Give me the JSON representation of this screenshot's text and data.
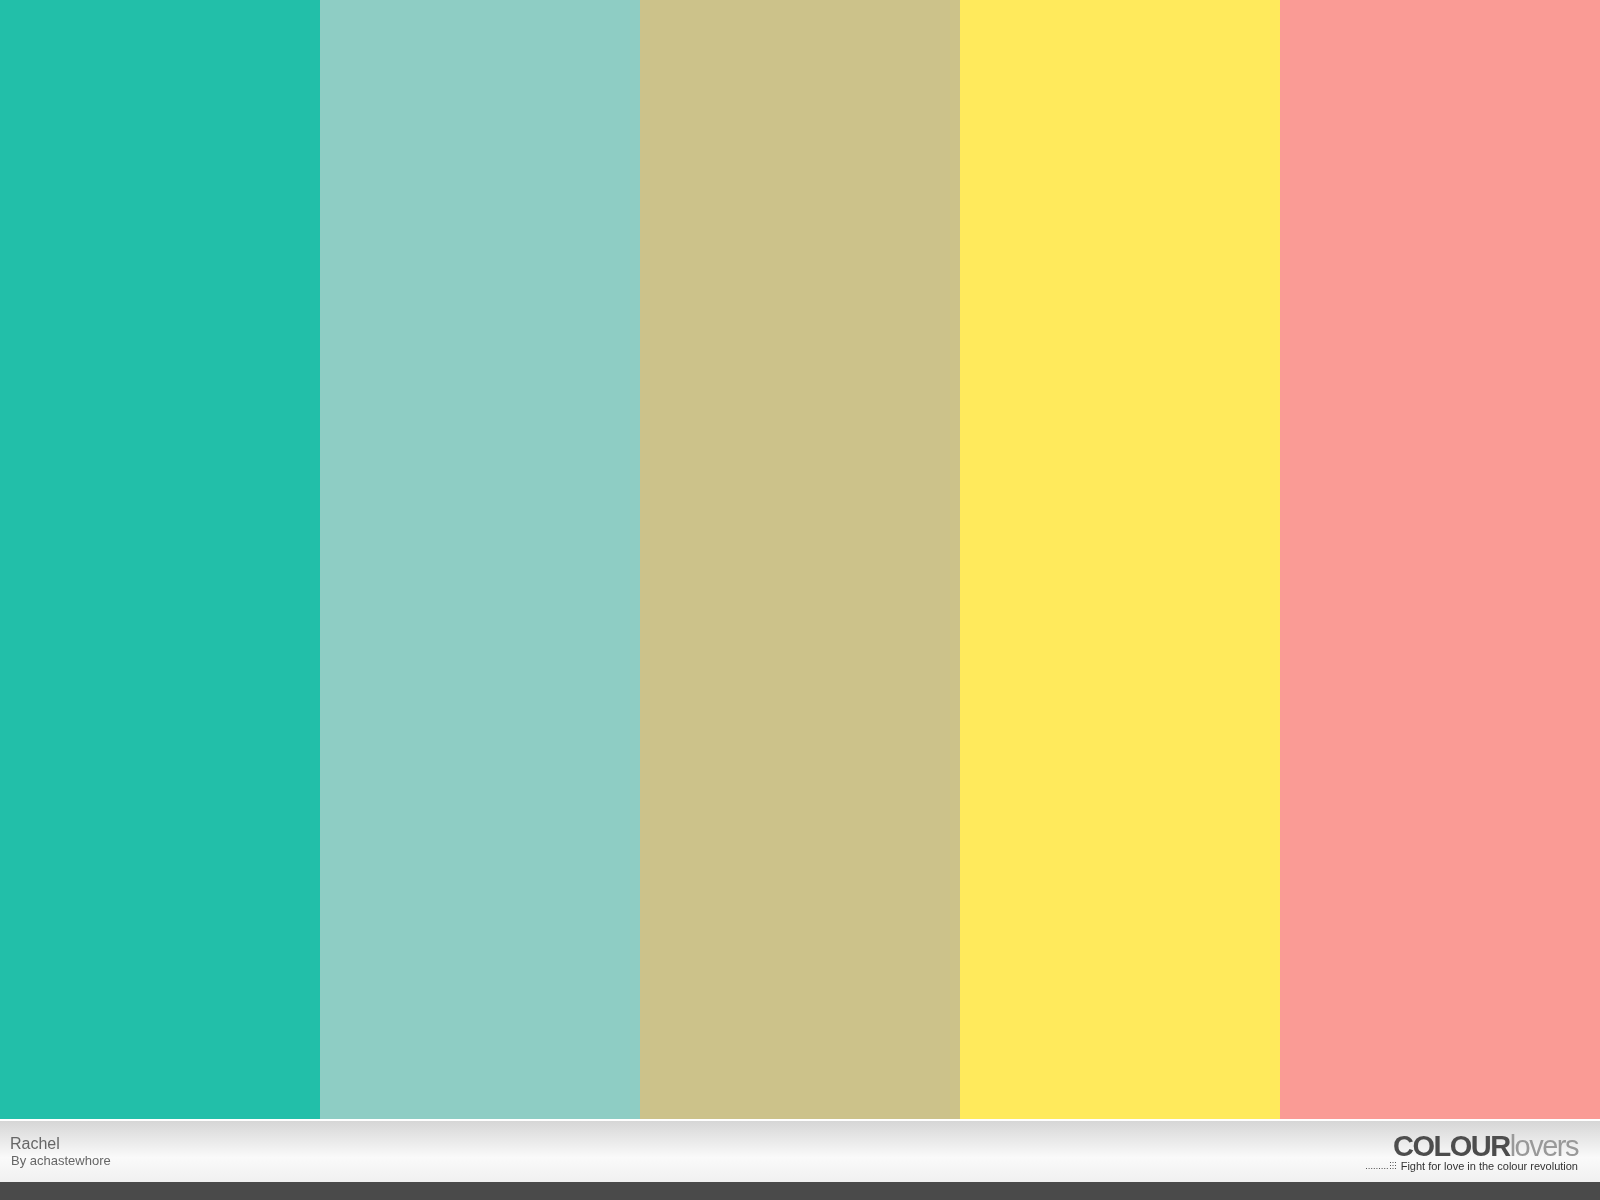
{
  "swatches": [
    {
      "color": "#22bfa9"
    },
    {
      "color": "#8ecdc4"
    },
    {
      "color": "#ccc28a"
    },
    {
      "color": "#ffea5c"
    },
    {
      "color": "#fa9b95"
    }
  ],
  "footer": {
    "title": "Rachel",
    "author": "By achastewhore",
    "logo": "**COLOUR**lovers",
    "tagline": "Fight for love in the colour revolution"
  }
}
